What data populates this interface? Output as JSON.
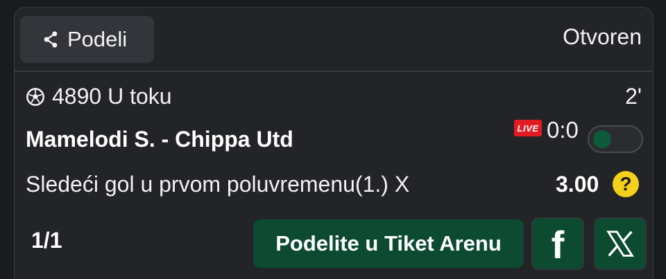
{
  "header": {
    "share_label": "Podeli",
    "status": "Otvoren"
  },
  "event": {
    "code_status": "4890 U toku",
    "minute": "2'",
    "match": "Mamelodi S. - Chippa Utd",
    "live_badge": "LIVE",
    "score": "0:0",
    "market": "Sledeći gol u prvom poluvremenu(1.) X",
    "odds": "3.00"
  },
  "footer": {
    "page_count": "1/1",
    "arena_button": "Podelite u Tiket Arenu",
    "facebook_glyph": "f"
  },
  "icons": {
    "share": "share-icon",
    "ball": "soccer-ball-icon",
    "help": "question-icon",
    "facebook": "facebook-icon",
    "x": "x-icon"
  },
  "colors": {
    "background": "#1a1b1d",
    "card": "#232427",
    "accent_green": "#0c4a32",
    "live_red": "#e21b23",
    "help_yellow": "#f5d01a"
  }
}
